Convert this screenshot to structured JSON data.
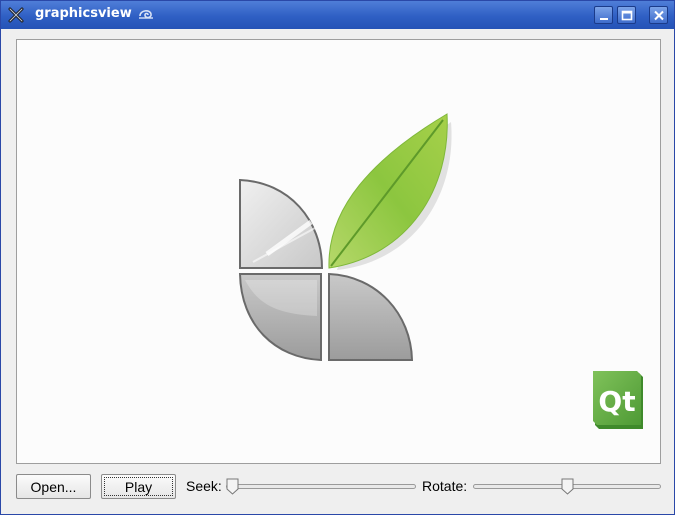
{
  "window": {
    "title": "graphicsview"
  },
  "icons": {
    "app": "x-app-icon",
    "title_decoration": "swirl-icon",
    "minimize": "minimize-icon",
    "maximize": "maximize-icon",
    "close": "close-icon"
  },
  "canvas": {
    "logo_text": "Qt"
  },
  "controls": {
    "open_label": "Open...",
    "play_label": "Play",
    "seek_label": "Seek:",
    "rotate_label": "Rotate:",
    "seek_value": 0.0,
    "rotate_value": 0.5
  },
  "colors": {
    "titlebar": "#2f5fc4",
    "leaf_green": "#8cc63f",
    "qt_green": "#6ab04c"
  }
}
